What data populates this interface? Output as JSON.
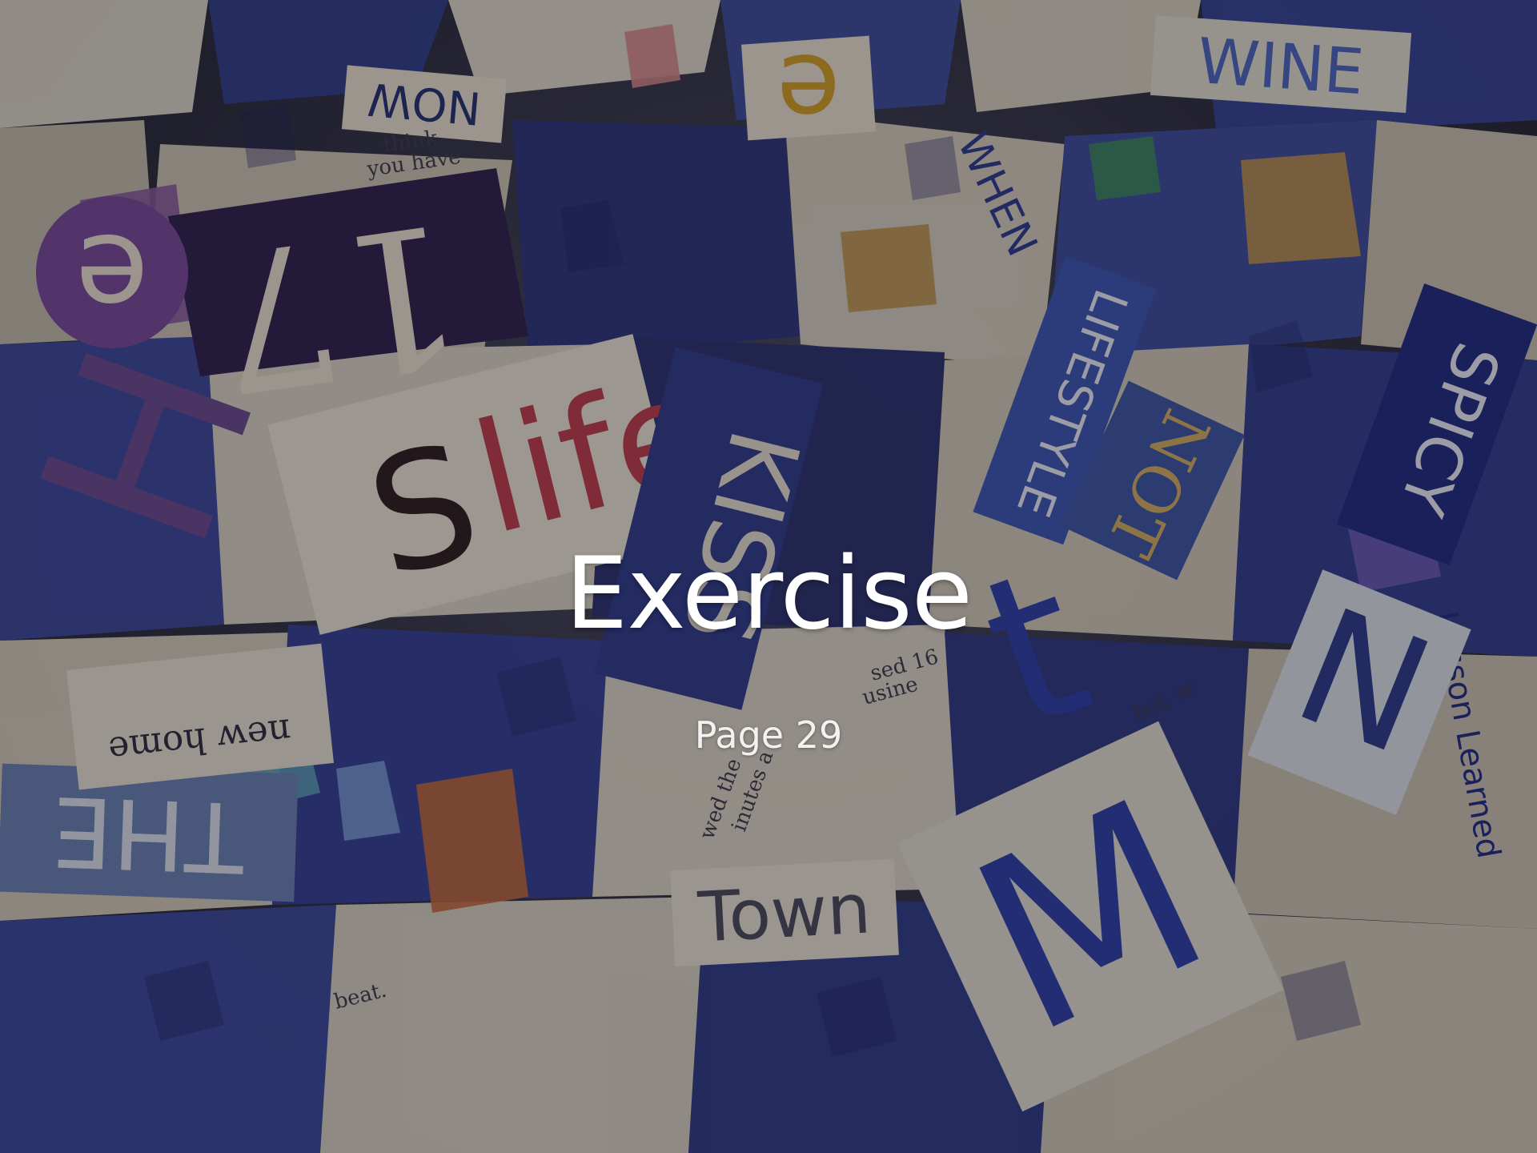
{
  "slide": {
    "title": "Exercise",
    "subtitle": "Page 29"
  },
  "background": {
    "image": "newspaper-collage-background",
    "overlay_color": "#14121e",
    "palette": [
      "#2c3a8c",
      "#f2ecdc",
      "#8a5a9c",
      "#c0954a",
      "#3a5ac8",
      "#c84a5a",
      "#1e1e3a"
    ],
    "cut_letters": [
      "WINE",
      "NOW",
      "e",
      "17",
      "life",
      "KISS",
      "LIFESTYLE",
      "NOT",
      "SPICY",
      "Lesson Learned",
      "Town",
      "THE",
      "new home",
      "WHEN",
      "M",
      "H"
    ]
  }
}
